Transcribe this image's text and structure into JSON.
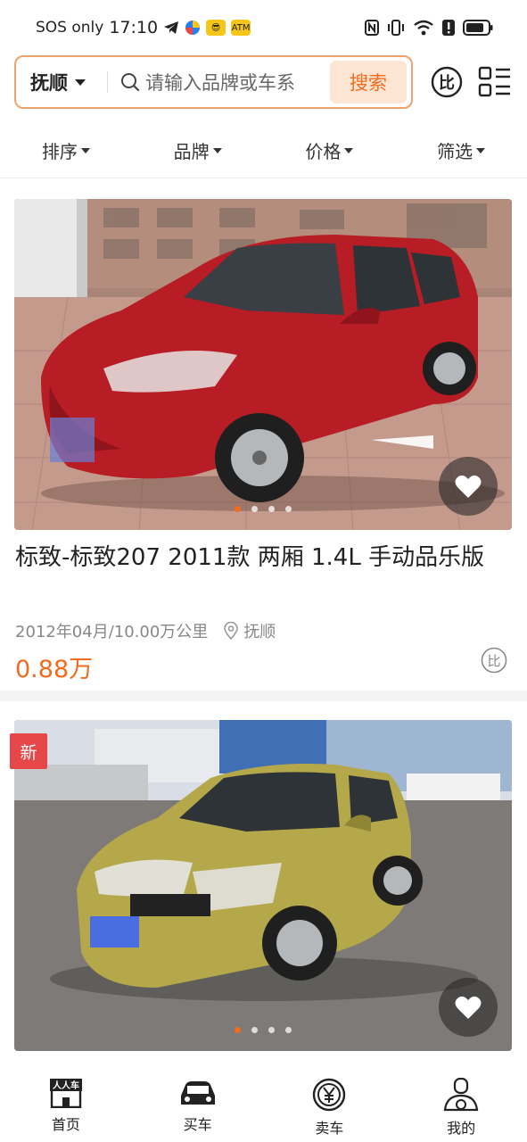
{
  "status_bar": {
    "carrier": "SOS only",
    "time": "17:10",
    "app_badge_text": "ATM",
    "icons": [
      "telegram-icon",
      "browser-icon",
      "meituan-icon",
      "app-icon",
      "nfc-icon",
      "vibrate-icon",
      "wifi-icon",
      "alert-icon",
      "battery-icon"
    ]
  },
  "search": {
    "city": "抚顺",
    "placeholder": "请输入品牌或车系",
    "button": "搜索",
    "compare_label": "比"
  },
  "filters": [
    "排序",
    "品牌",
    "价格",
    "筛选"
  ],
  "listings": [
    {
      "title": "标致-标致207 2011款 两厢 1.4L 手动品乐版",
      "date_mileage": "2012年04月/10.00万公里",
      "location": "抚顺",
      "price": "0.88万",
      "compare_label": "比",
      "photo_dots": 4,
      "active_dot": 0,
      "car_color": "#b81c24"
    },
    {
      "tag": "新",
      "photo_dots": 4,
      "active_dot": 0,
      "car_color": "#b5a84a"
    }
  ],
  "bottom_nav": [
    {
      "label": "首页",
      "icon": "home-icon",
      "logo_text": "人人车"
    },
    {
      "label": "买车",
      "icon": "car-icon"
    },
    {
      "label": "卖车",
      "icon": "yuan-icon"
    },
    {
      "label": "我的",
      "icon": "profile-icon"
    }
  ],
  "colors": {
    "accent": "#f26b1d",
    "search_border": "#f0a26b",
    "search_button_bg": "#fde5d3",
    "new_tag": "#e8474a"
  }
}
